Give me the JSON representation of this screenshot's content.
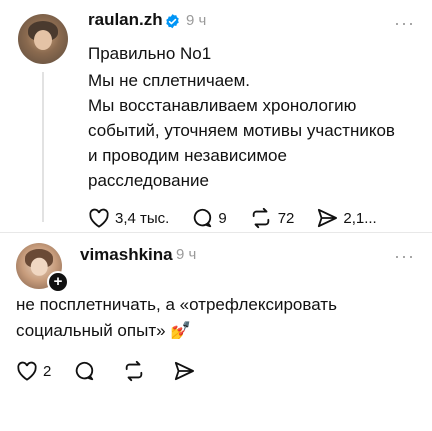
{
  "posts": [
    {
      "username": "raulan.zh",
      "time": "9 ч",
      "more": "···",
      "lines": [
        "Правильно No1",
        "Мы не сплетничаем.",
        "Мы восстанавливаем хронологию",
        "событий, уточняем мотивы участников",
        "и проводим независимое",
        "расследование"
      ],
      "actions": {
        "likes": "3,4 тыс.",
        "replies": "9",
        "reposts": "72",
        "shares": "2,1..."
      }
    },
    {
      "username": "vimashkina",
      "time": "9 ч",
      "more": "···",
      "lines": [
        "не посплетничать, а «отрефлексировать",
        "социальный опыт» 💅"
      ],
      "actions": {
        "likes": "2"
      }
    }
  ],
  "colors": {
    "verified": "#0095f6",
    "muted": "#9a9a9a",
    "text": "#111111"
  }
}
